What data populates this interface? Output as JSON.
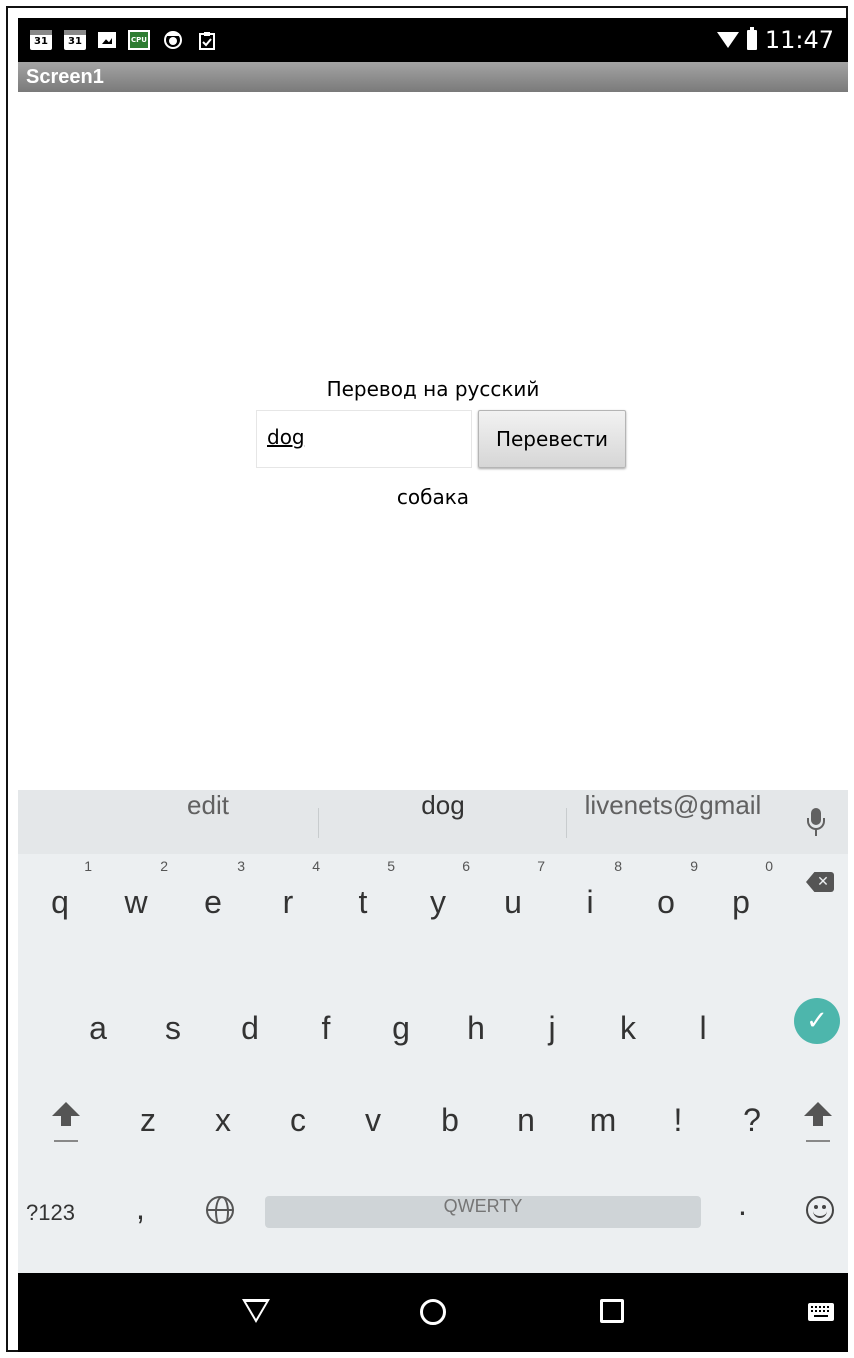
{
  "status_bar": {
    "icons": [
      "calendar-icon",
      "calendar-icon",
      "image-icon",
      "cpu-icon",
      "android-debug-icon",
      "clipboard-check-icon"
    ],
    "calendar_day": "31",
    "cpu_label": "CPU",
    "clock": "11:47"
  },
  "title_bar": {
    "title": "Screen1"
  },
  "app": {
    "heading": "Перевод на русский",
    "input_value": "dog",
    "translate_button": "Перевести",
    "result": "собака"
  },
  "keyboard": {
    "suggestions": [
      "edit",
      "dog",
      "livenets@gmail"
    ],
    "row1": [
      {
        "letter": "q",
        "num": "1"
      },
      {
        "letter": "w",
        "num": "2"
      },
      {
        "letter": "e",
        "num": "3"
      },
      {
        "letter": "r",
        "num": "4"
      },
      {
        "letter": "t",
        "num": "5"
      },
      {
        "letter": "y",
        "num": "6"
      },
      {
        "letter": "u",
        "num": "7"
      },
      {
        "letter": "i",
        "num": "8"
      },
      {
        "letter": "o",
        "num": "9"
      },
      {
        "letter": "p",
        "num": "0"
      }
    ],
    "row2": [
      "a",
      "s",
      "d",
      "f",
      "g",
      "h",
      "j",
      "k",
      "l"
    ],
    "row3": [
      "z",
      "x",
      "c",
      "v",
      "b",
      "n",
      "m",
      "!",
      "?"
    ],
    "symbols_key": "?123",
    "comma_key": ",",
    "space_label": "QWERTY",
    "period_key": ".",
    "enter_symbol": "✓",
    "backspace_symbol": "✕",
    "accent_color": "#4db6ac"
  },
  "nav_bar": {
    "icons": [
      "back-icon",
      "home-icon",
      "recents-icon",
      "keyboard-switch-icon"
    ]
  }
}
